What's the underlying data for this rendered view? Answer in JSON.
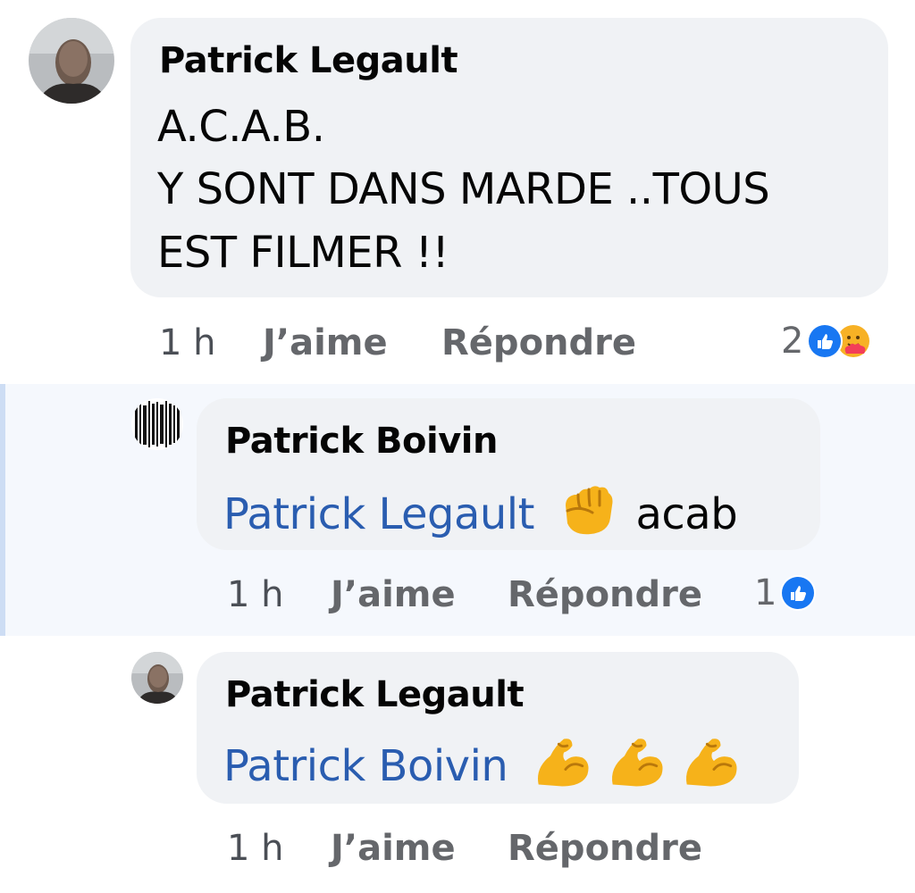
{
  "comments": [
    {
      "author": "Patrick Legault",
      "lines": [
        "A.C.A.B.",
        "Y SONT DANS MARDE ..TOUS",
        "EST FILMER !!"
      ],
      "time": "1 h",
      "like_label": "J’aime",
      "reply_label": "Répondre",
      "reaction_count": "2",
      "reactions": [
        "like-icon",
        "care-icon"
      ]
    },
    {
      "author": "Patrick Boivin",
      "mention": "Patrick Legault",
      "emoji": "raised-fist-icon",
      "text": "acab",
      "time": "1 h",
      "like_label": "J’aime",
      "reply_label": "Répondre",
      "reaction_count": "1",
      "reactions": [
        "like-icon"
      ]
    },
    {
      "author": "Patrick Legault",
      "mention": "Patrick Boivin",
      "emoji": [
        "flexed-biceps-icon",
        "flexed-biceps-icon",
        "flexed-biceps-icon"
      ],
      "time": "1 h",
      "like_label": "J’aime",
      "reply_label": "Répondre"
    }
  ],
  "colors": {
    "bubble": "#f0f2f5",
    "mention": "#2a5db0",
    "meta": "#65676b",
    "like_blue": "#1877f2",
    "highlight": "#f5f8fd"
  }
}
